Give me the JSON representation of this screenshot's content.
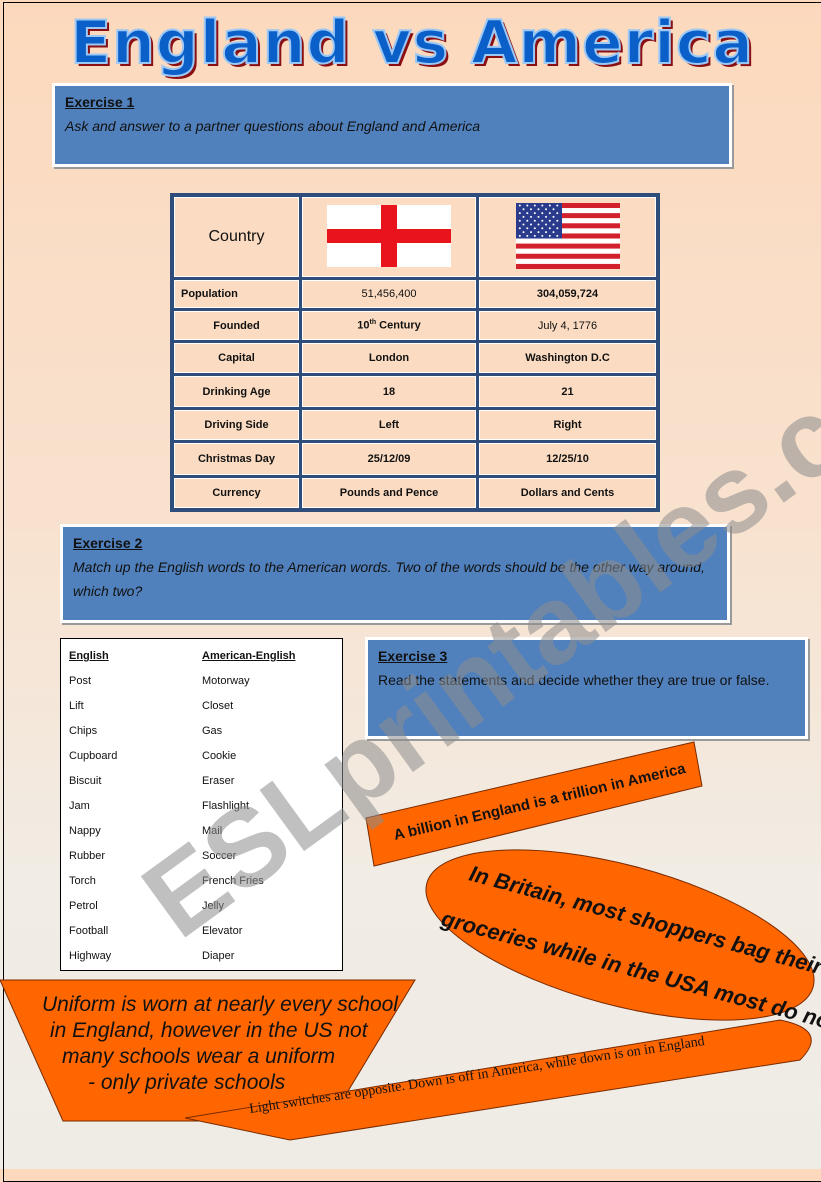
{
  "title": "England vs America",
  "exercise1": {
    "heading": "Exercise 1",
    "text": "Ask and answer to a partner questions about England and America"
  },
  "table": {
    "header": "Country",
    "flags": [
      "england-flag",
      "usa-flag"
    ],
    "rows": [
      {
        "label": "Population",
        "england": "51,456,400",
        "america": "304,059,724"
      },
      {
        "label": "Founded",
        "england": "10th Century",
        "america": "July 4, 1776"
      },
      {
        "label": "Capital",
        "england": "London",
        "america": "Washington D.C"
      },
      {
        "label": "Drinking Age",
        "england": "18",
        "america": "21"
      },
      {
        "label": "Driving Side",
        "england": "Left",
        "america": "Right"
      },
      {
        "label": "Christmas Day",
        "england": "25/12/09",
        "america": "12/25/10"
      },
      {
        "label": "Currency",
        "england": "Pounds and Pence",
        "america": "Dollars and Cents"
      }
    ]
  },
  "exercise2": {
    "heading": "Exercise 2",
    "text": "Match up the English words to the American words. Two of the words should be the other way around, which two?"
  },
  "words": {
    "english_header": "English",
    "american_header": "American-English",
    "english": [
      "Post",
      "Lift",
      "Chips",
      "Cupboard",
      "Biscuit",
      "Jam",
      "Nappy",
      "Rubber",
      "Torch",
      "Petrol",
      "Football",
      "Highway"
    ],
    "american": [
      "Motorway",
      "Closet",
      "Gas",
      "Cookie",
      "Eraser",
      "Flashlight",
      "Mail",
      "Soccer",
      "French Fries",
      "Jelly",
      "Elevator",
      "Diaper"
    ]
  },
  "exercise3": {
    "heading": "Exercise 3",
    "text": "Read the statements and decide whether they are true or false."
  },
  "statements": [
    "A billion in England is a trillion in America",
    "In Britain, most shoppers bag their own groceries while in the USA most do not.",
    "Uniform is worn at nearly every school in England, however in the US not many schools wear a uniform - only private schools",
    "Light switches are opposite. Down is off in America, while down is on in England"
  ],
  "watermark": "ESLprintables.com",
  "colors": {
    "exercise_box": "#5181bd",
    "shape_fill": "#ff6600",
    "table_border": "#2f4d7a",
    "title": "#0b5fc8"
  }
}
